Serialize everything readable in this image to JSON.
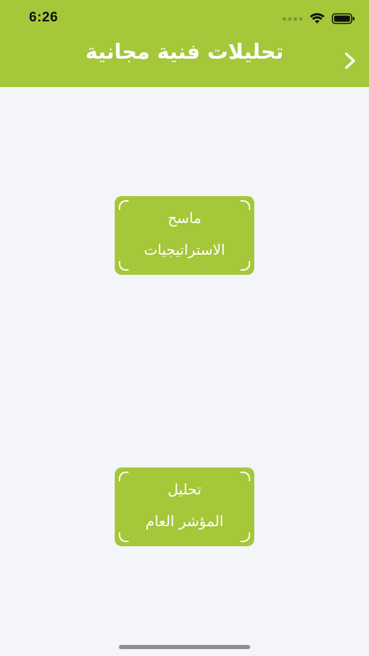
{
  "status_bar": {
    "time": "6:26"
  },
  "header": {
    "title": "تحليلات فنية مجانية",
    "back_icon": "chevron-right-icon",
    "color": "#a5c73a"
  },
  "menu": [
    {
      "line1": "ماسح",
      "line2": "الاستراتيجيات"
    },
    {
      "line1": "تحليل",
      "line2": "المؤشر العام"
    }
  ],
  "colors": {
    "accent": "#a5c73a",
    "background": "#f3f5f9",
    "text_on_accent": "#ffffff"
  }
}
